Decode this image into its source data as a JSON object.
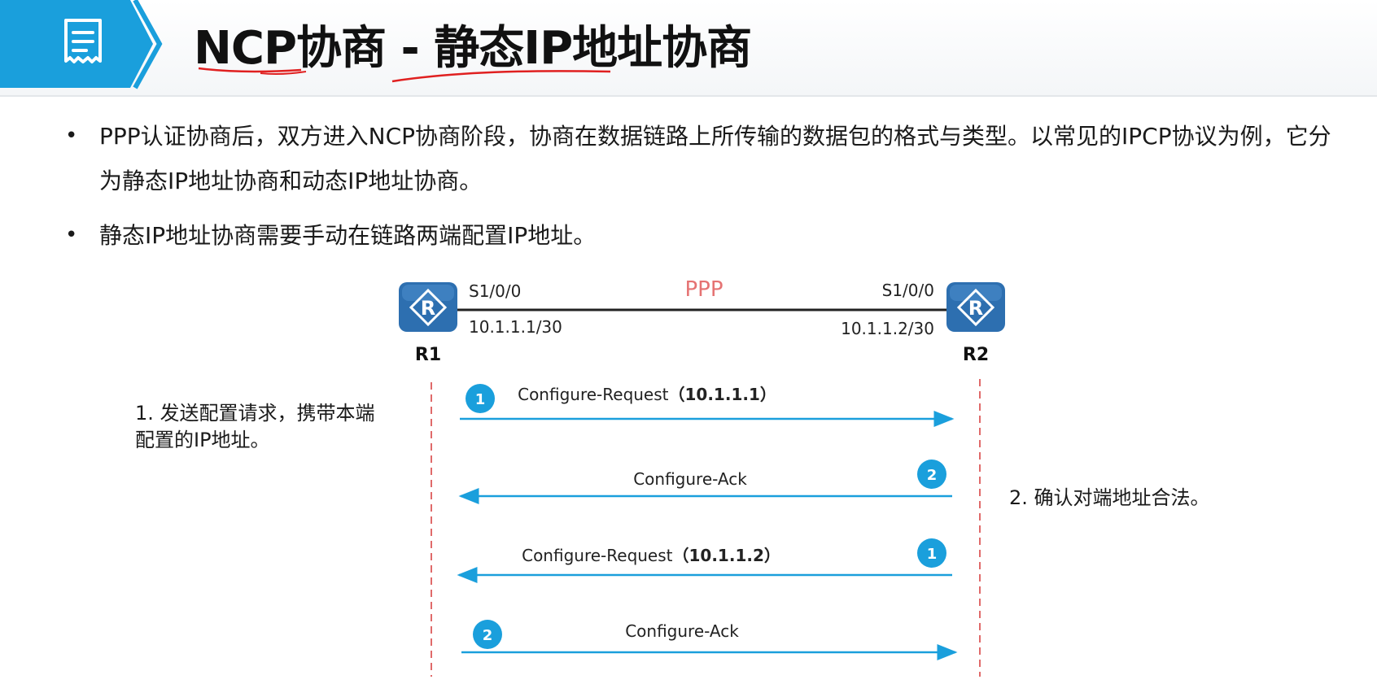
{
  "title": "NCP协商 - 静态IP地址协商",
  "bullets": [
    "PPP认证协商后，双方进入NCP协商阶段，协商在数据链路上所传输的数据包的格式与类型。以常见的IPCP协议为例，它分为静态IP地址协商和动态IP地址协商。",
    "静态IP地址协商需要手动在链路两端配置IP地址。"
  ],
  "topology": {
    "link_label": "PPP",
    "r1": {
      "name": "R1",
      "icon_letter": "R",
      "interface": "S1/0/0",
      "ip": "10.1.1.1/30"
    },
    "r2": {
      "name": "R2",
      "icon_letter": "R",
      "interface": "S1/0/0",
      "ip": "10.1.1.2/30"
    }
  },
  "notes": {
    "left_line1": "1. 发送配置请求，携带本端",
    "left_line2": "配置的IP地址。",
    "right": "2. 确认对端地址合法。"
  },
  "messages": [
    {
      "label": "Configure-Request",
      "param": "（10.1.1.1）",
      "direction": "right",
      "step": "1"
    },
    {
      "label": "Configure-Ack",
      "param": "",
      "direction": "left",
      "step": "2"
    },
    {
      "label": "Configure-Request",
      "param": "（10.1.1.2）",
      "direction": "left",
      "step": "1"
    },
    {
      "label": "Configure-Ack",
      "param": "",
      "direction": "right",
      "step": "2"
    }
  ],
  "colors": {
    "accent_blue": "#1a9fdc",
    "router_blue": "#2d6fb0",
    "lifeline_red": "#e06a6a",
    "ppp_red": "#e57373",
    "annotation_red": "#e02020"
  }
}
